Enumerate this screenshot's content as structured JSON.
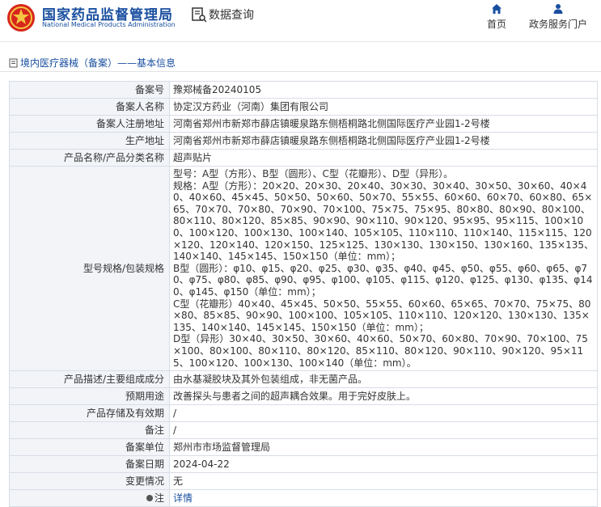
{
  "header": {
    "brand_cn": "国家药品监督管理局",
    "brand_en": "National Medical Products Administration",
    "section_title": "数据查询",
    "nav": [
      {
        "label": "首页",
        "icon": "home-icon"
      },
      {
        "label": "政务服务门户",
        "icon": "person-icon"
      }
    ]
  },
  "breadcrumb": {
    "text": "境内医疗器械（备案）——基本信息"
  },
  "colors": {
    "brand": "#1a4fa0",
    "label_bg": "#f2f4f8",
    "border": "#d8dde6"
  },
  "record": {
    "rows": [
      {
        "label": "备案号",
        "value": "豫郑械备20240105"
      },
      {
        "label": "备案人名称",
        "value": "协定汉方药业（河南）集团有限公司"
      },
      {
        "label": "备案人注册地址",
        "value": "河南省郑州市新郑市薛店镇暖泉路东侧梧桐路北侧国际医疗产业园1-2号楼"
      },
      {
        "label": "生产地址",
        "value": "河南省郑州市新郑市薛店镇暖泉路东侧梧桐路北侧国际医疗产业园1-2号楼"
      },
      {
        "label": "产品名称/产品分类名称",
        "value": "超声贴片"
      }
    ],
    "spec": {
      "label": "型号规格/包装规格",
      "lines": [
        "型号：A型（方形）、B型（圆形）、C型（花瓣形）、D型（异形）。",
        "规格：A型（方形）：20×20、20×30、20×40、30×30、30×40、30×50、30×60、40×40、40×60、45×45、50×50、50×60、50×70、55×55、60×60、60×70、60×80、65×65、70×70、70×80、70×90、70×100、75×75、75×95、80×80、80×90、80×100、80×110、80×120、85×85、90×90、90×110、90×120、95×95、95×115、100×100、100×120、100×130、100×140、105×105、110×110、110×140、115×115、120×120、120×140、120×150、125×125、130×130、130×150、130×160、135×135、140×140、145×145、150×150（单位：mm）；",
        "B型（圆形）：φ10、φ15、φ20、φ25、φ30、φ35、φ40、φ45、φ50、φ55、φ60、φ65、φ70、φ75、φ80、φ85、φ90、φ95、φ100、φ105、φ115、φ120、φ125、φ130、φ135、φ140、φ145、φ150（单位：mm）；",
        "C型（花瓣形）40×40、45×45、50×50、55×55、60×60、65×65、70×70、75×75、80×80、85×85、90×90、100×100、105×105、110×110、120×120、130×130、135×135、140×140、145×145、150×150（单位：mm）；",
        "D型（异形）30×40、30×50、30×60、40×60、50×70、60×80、70×90、70×100、75×100、80×100、80×110、80×120、85×110、80×120、90×110、90×120、95×115、100×120、100×130、100×140（单位：mm）。"
      ]
    },
    "rows2": [
      {
        "label": "产品描述/主要组成成分",
        "value": "由水基凝胶块及其外包装组成，非无菌产品。"
      },
      {
        "label": "预期用途",
        "value": "改善探头与患者之间的超声耦合效果。用于完好皮肤上。"
      },
      {
        "label": "产品存储及有效期",
        "value": "/"
      },
      {
        "label": "备注",
        "value": "/"
      },
      {
        "label": "备案单位",
        "value": "郑州市市场监督管理局"
      },
      {
        "label": "备案日期",
        "value": "2024-04-22"
      },
      {
        "label": "变更情况",
        "value": "无"
      }
    ],
    "note": {
      "label": "注",
      "link": "详情"
    }
  }
}
